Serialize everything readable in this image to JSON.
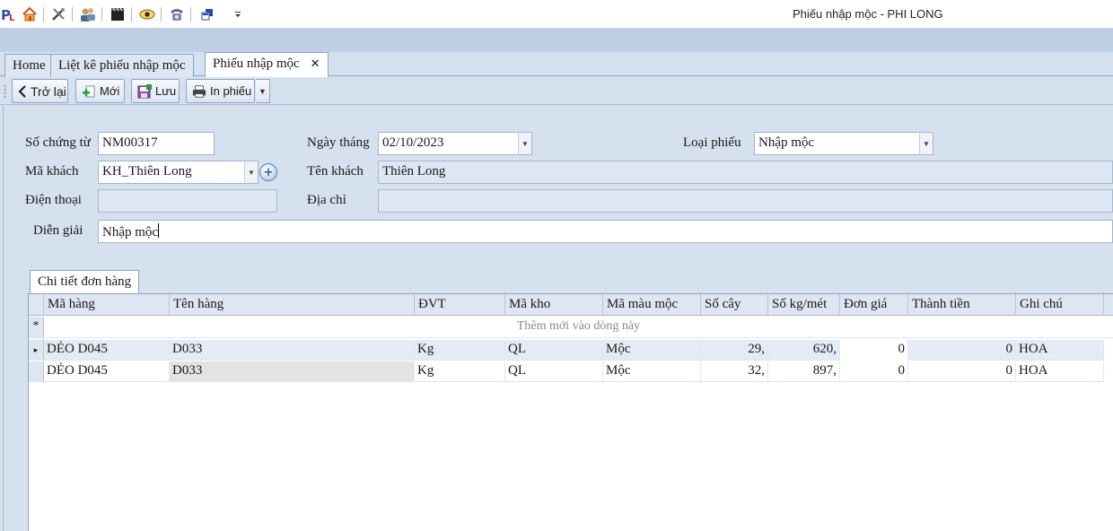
{
  "window": {
    "title": "Phiếu nhập mộc - PHI LONG"
  },
  "quick_access": {
    "icons": [
      "app-logo-icon",
      "home-icon",
      "tools-icon",
      "users-icon",
      "film-icon",
      "eye-icon",
      "phone-icon",
      "windows-icon",
      "customize-icon"
    ]
  },
  "tabs": [
    {
      "label": "Home",
      "active": false
    },
    {
      "label": "Liệt kê phiếu nhập mộc",
      "active": false
    },
    {
      "label": "Phiếu nhập mộc",
      "active": true
    }
  ],
  "tab_close_glyph": "✕",
  "toolbar": {
    "back_label": "Trở lại",
    "new_label": "Mới",
    "save_label": "Lưu",
    "print_label": "In phiếu"
  },
  "form": {
    "so_chung_tu_label": "Số chứng từ",
    "so_chung_tu_value": "NM00317",
    "ngay_thang_label": "Ngày tháng",
    "ngay_thang_value": "02/10/2023",
    "loai_phieu_label": "Loại phiếu",
    "loai_phieu_value": "Nhập mộc",
    "ma_khach_label": "Mã khách",
    "ma_khach_value": "KH_Thiên Long",
    "ten_khach_label": "Tên khách",
    "ten_khach_value": "Thiên Long",
    "dien_thoai_label": "Điện thoại",
    "dien_thoai_value": "",
    "dia_chi_label": "Địa chỉ",
    "dia_chi_value": "",
    "dien_giai_label": "Diễn giải",
    "dien_giai_value": "Nhập mộc"
  },
  "detail": {
    "tab_label": "Chi tiết đơn hàng",
    "columns": [
      "Mã hàng",
      "Tên hàng",
      "ĐVT",
      "Mã kho",
      "Mã màu mộc",
      "Số cây",
      "Số kg/mét",
      "Đơn giá",
      "Thành tiền",
      "Ghi chú"
    ],
    "new_row_marker": "*",
    "new_row_text": "Thêm mới vào dòng này",
    "current_row_marker": "▸",
    "rows": [
      [
        "DẺO D045",
        "D033",
        "Kg",
        "QL",
        "Mộc",
        "29,",
        "620,",
        "0",
        "0",
        "HOA"
      ],
      [
        "DẺO D045",
        "D033",
        "Kg",
        "QL",
        "Mộc",
        "32,",
        "897,",
        "0",
        "0",
        "HOA"
      ]
    ]
  },
  "colors": {
    "background": "#d6e1ef",
    "ribbon": "#bfd0e6",
    "selected_row": "#e4ebf5"
  }
}
